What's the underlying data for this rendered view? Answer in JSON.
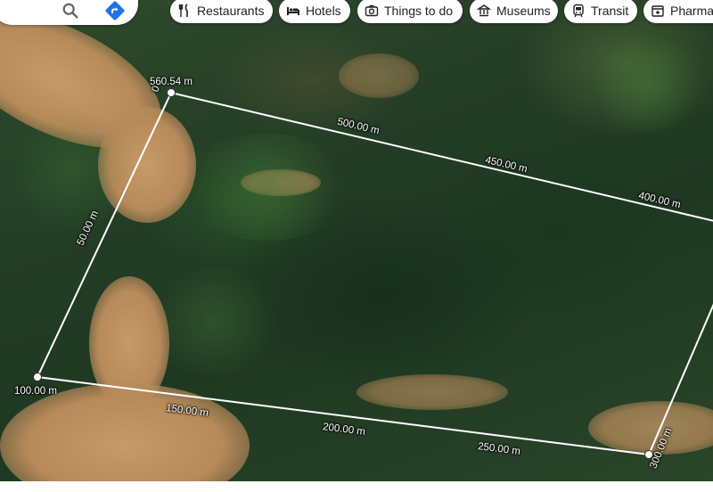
{
  "toolbar": {
    "search_icon": "search-icon",
    "directions_icon": "directions-icon",
    "chips": [
      {
        "label": "Restaurants",
        "icon": "restaurant-icon"
      },
      {
        "label": "Hotels",
        "icon": "hotel-icon"
      },
      {
        "label": "Things to do",
        "icon": "camera-icon"
      },
      {
        "label": "Museums",
        "icon": "museum-icon"
      },
      {
        "label": "Transit",
        "icon": "transit-icon"
      },
      {
        "label": "Pharma",
        "icon": "pharmacy-icon"
      }
    ]
  },
  "measurement": {
    "total_label": "560.54 m",
    "start_label": "0",
    "labels": [
      "500.00 m",
      "450.00 m",
      "400.00 m",
      "50.00 m",
      "100.00 m",
      "150.00 m",
      "200.00 m",
      "250.00 m",
      "300.00 m"
    ]
  },
  "colors": {
    "accent_blue": "#1a73e8",
    "line": "#ffffff"
  }
}
